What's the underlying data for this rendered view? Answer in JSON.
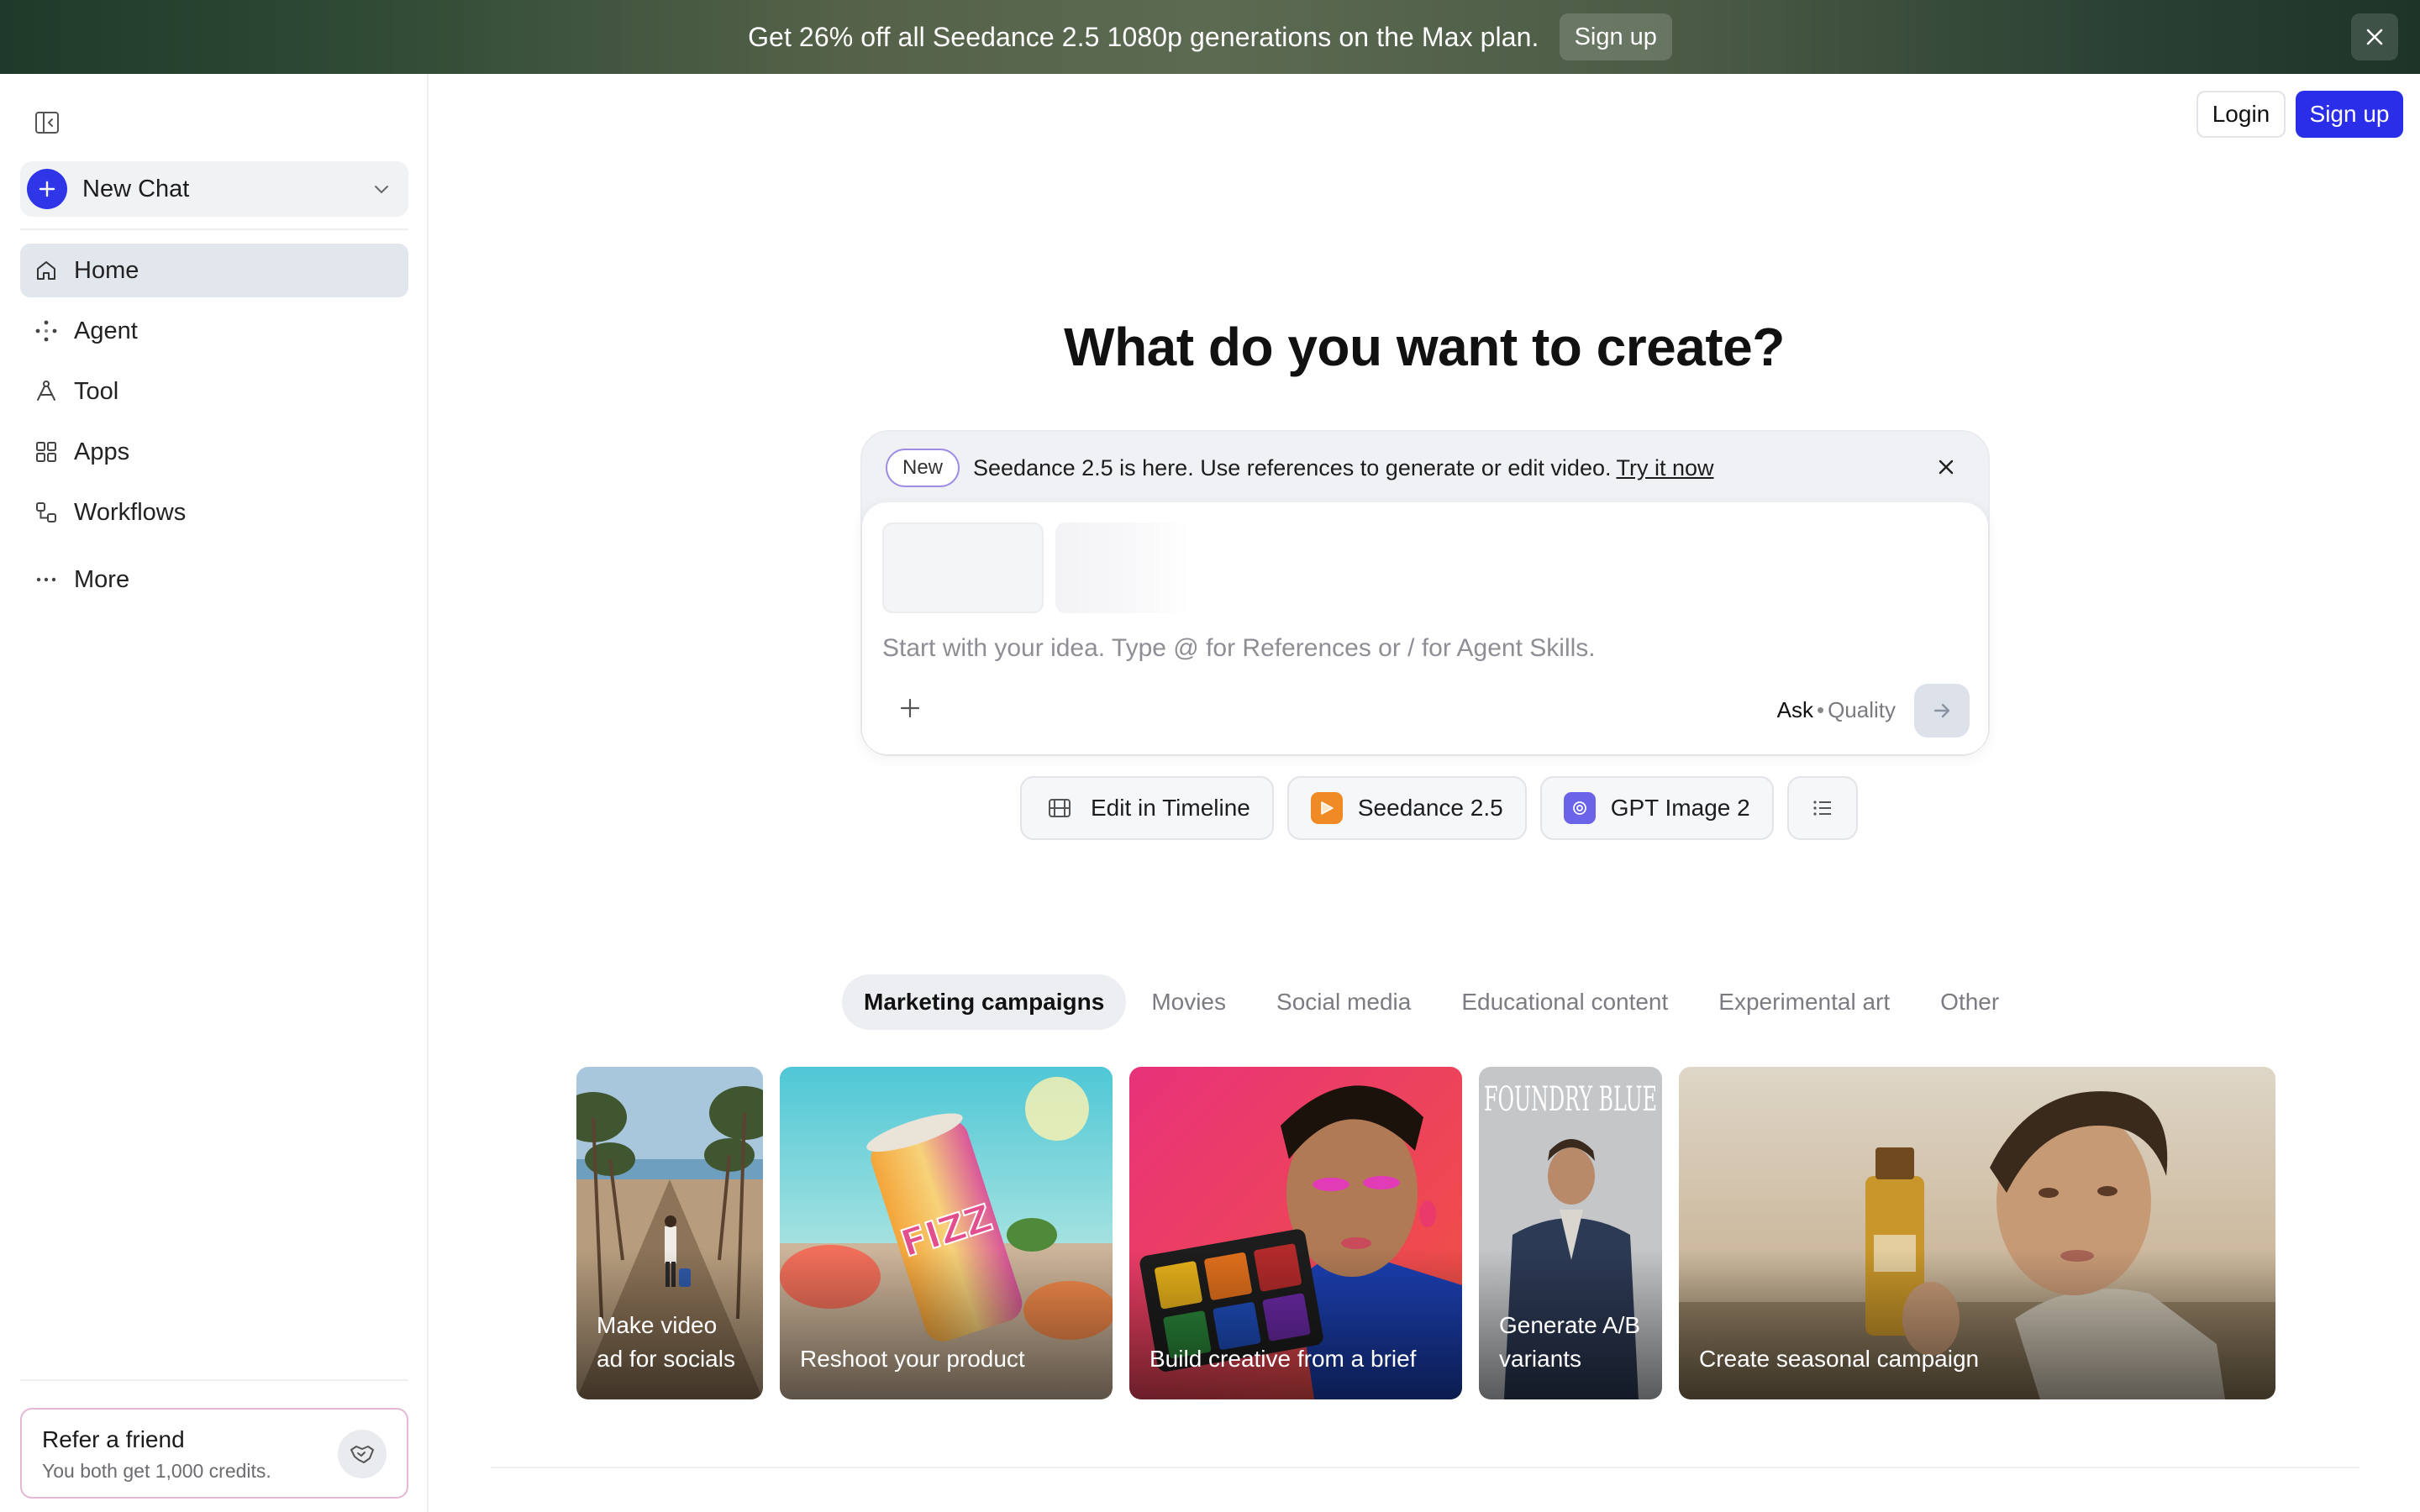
{
  "banner": {
    "text": "Get 26% off all Seedance 2.5 1080p generations on the Max plan.",
    "signup_label": "Sign up"
  },
  "sidebar": {
    "new_chat_label": "New Chat",
    "items": [
      {
        "label": "Home",
        "icon": "home-icon",
        "active": true
      },
      {
        "label": "Agent",
        "icon": "agent-icon"
      },
      {
        "label": "Tool",
        "icon": "tool-icon"
      },
      {
        "label": "Apps",
        "icon": "apps-icon"
      },
      {
        "label": "Workflows",
        "icon": "workflows-icon"
      },
      {
        "label": "More",
        "icon": "more-icon"
      }
    ],
    "refer": {
      "title": "Refer a friend",
      "subtitle": "You both get 1,000 credits."
    }
  },
  "header": {
    "login_label": "Login",
    "signup_label": "Sign up"
  },
  "main": {
    "heading": "What do you want to create?",
    "announcement": {
      "badge": "New",
      "text": "Seedance 2.5 is here. Use references to generate or edit video.",
      "link": "Try it now"
    },
    "prompt": {
      "placeholder": "Start with your idea. Type @ for References or / for Agent Skills.",
      "mode_ask": "Ask",
      "mode_sep": "•",
      "mode_quality": "Quality"
    },
    "chips": [
      {
        "label": "Edit in Timeline",
        "icon": "timeline-icon"
      },
      {
        "label": "Seedance 2.5",
        "icon": "seedance-icon",
        "color": "#f08a24"
      },
      {
        "label": "GPT Image 2",
        "icon": "gpt-icon",
        "color": "#6b63e8"
      }
    ],
    "tabs": [
      {
        "label": "Marketing campaigns",
        "active": true
      },
      {
        "label": "Movies"
      },
      {
        "label": "Social media"
      },
      {
        "label": "Educational content"
      },
      {
        "label": "Experimental art"
      },
      {
        "label": "Other"
      }
    ],
    "gallery": [
      {
        "label_line1": "Make video",
        "label_line2": "ad for socials"
      },
      {
        "label_line1": "Reshoot your product",
        "label_line2": ""
      },
      {
        "label_line1": "Build creative from a brief",
        "label_line2": ""
      },
      {
        "label_line1": "Generate A/B",
        "label_line2": "variants",
        "magazine_title": "FOUNDRY BLUE"
      },
      {
        "label_line1": "Create seasonal campaign",
        "label_line2": ""
      }
    ]
  },
  "colors": {
    "accent": "#2a2ee8",
    "new_chat_plus": "#2e36e8",
    "refer_border": "#e4b7d4",
    "new_badge_border": "#9f8ce3"
  }
}
